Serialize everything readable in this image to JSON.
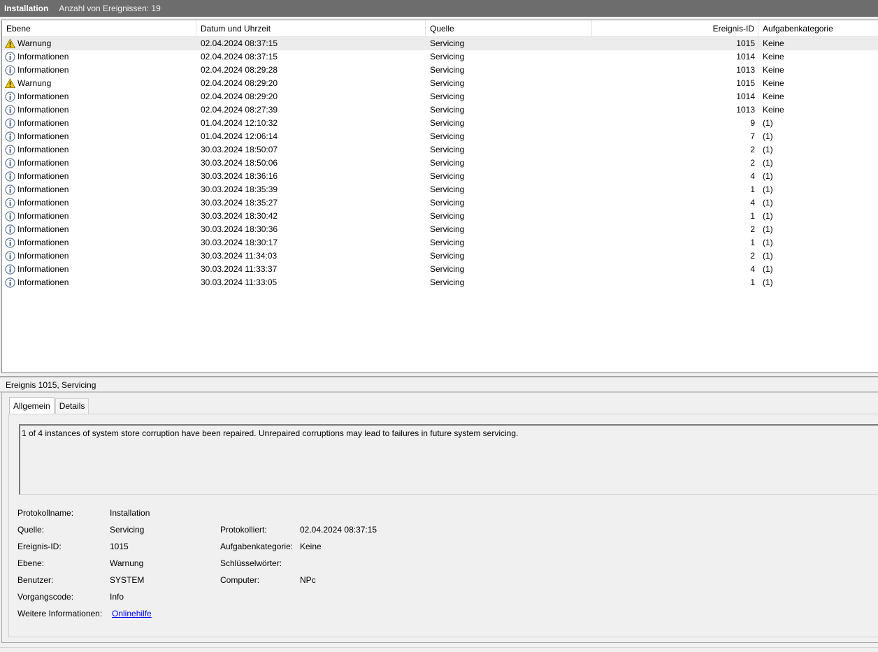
{
  "title_bar": {
    "title": "Installation",
    "count_text": "Anzahl von Ereignissen: 19"
  },
  "columns": [
    "Ebene",
    "Datum und Uhrzeit",
    "Quelle",
    "Ereignis-ID",
    "Aufgabenkategorie"
  ],
  "icons": {
    "warning": "warning-icon",
    "info": "info-icon"
  },
  "events": [
    {
      "icon": "warning",
      "level": "Warnung",
      "date": "02.04.2024 08:37:15",
      "source": "Servicing",
      "id": "1015",
      "category": "Keine"
    },
    {
      "icon": "info",
      "level": "Informationen",
      "date": "02.04.2024 08:37:15",
      "source": "Servicing",
      "id": "1014",
      "category": "Keine"
    },
    {
      "icon": "info",
      "level": "Informationen",
      "date": "02.04.2024 08:29:28",
      "source": "Servicing",
      "id": "1013",
      "category": "Keine"
    },
    {
      "icon": "warning",
      "level": "Warnung",
      "date": "02.04.2024 08:29:20",
      "source": "Servicing",
      "id": "1015",
      "category": "Keine"
    },
    {
      "icon": "info",
      "level": "Informationen",
      "date": "02.04.2024 08:29:20",
      "source": "Servicing",
      "id": "1014",
      "category": "Keine"
    },
    {
      "icon": "info",
      "level": "Informationen",
      "date": "02.04.2024 08:27:39",
      "source": "Servicing",
      "id": "1013",
      "category": "Keine"
    },
    {
      "icon": "info",
      "level": "Informationen",
      "date": "01.04.2024 12:10:32",
      "source": "Servicing",
      "id": "9",
      "category": "(1)"
    },
    {
      "icon": "info",
      "level": "Informationen",
      "date": "01.04.2024 12:06:14",
      "source": "Servicing",
      "id": "7",
      "category": "(1)"
    },
    {
      "icon": "info",
      "level": "Informationen",
      "date": "30.03.2024 18:50:07",
      "source": "Servicing",
      "id": "2",
      "category": "(1)"
    },
    {
      "icon": "info",
      "level": "Informationen",
      "date": "30.03.2024 18:50:06",
      "source": "Servicing",
      "id": "2",
      "category": "(1)"
    },
    {
      "icon": "info",
      "level": "Informationen",
      "date": "30.03.2024 18:36:16",
      "source": "Servicing",
      "id": "4",
      "category": "(1)"
    },
    {
      "icon": "info",
      "level": "Informationen",
      "date": "30.03.2024 18:35:39",
      "source": "Servicing",
      "id": "1",
      "category": "(1)"
    },
    {
      "icon": "info",
      "level": "Informationen",
      "date": "30.03.2024 18:35:27",
      "source": "Servicing",
      "id": "4",
      "category": "(1)"
    },
    {
      "icon": "info",
      "level": "Informationen",
      "date": "30.03.2024 18:30:42",
      "source": "Servicing",
      "id": "1",
      "category": "(1)"
    },
    {
      "icon": "info",
      "level": "Informationen",
      "date": "30.03.2024 18:30:36",
      "source": "Servicing",
      "id": "2",
      "category": "(1)"
    },
    {
      "icon": "info",
      "level": "Informationen",
      "date": "30.03.2024 18:30:17",
      "source": "Servicing",
      "id": "1",
      "category": "(1)"
    },
    {
      "icon": "info",
      "level": "Informationen",
      "date": "30.03.2024 11:34:03",
      "source": "Servicing",
      "id": "2",
      "category": "(1)"
    },
    {
      "icon": "info",
      "level": "Informationen",
      "date": "30.03.2024 11:33:37",
      "source": "Servicing",
      "id": "4",
      "category": "(1)"
    },
    {
      "icon": "info",
      "level": "Informationen",
      "date": "30.03.2024 11:33:05",
      "source": "Servicing",
      "id": "1",
      "category": "(1)"
    }
  ],
  "detail": {
    "title": "Ereignis 1015, Servicing",
    "tabs": [
      "Allgemein",
      "Details"
    ],
    "description": "1 of 4 instances of system store corruption have been repaired. Unrepaired corruptions may lead to failures in future system servicing.",
    "labels": {
      "log_name": "Protokollname:",
      "source": "Quelle:",
      "event_id": "Ereignis-ID:",
      "level": "Ebene:",
      "user": "Benutzer:",
      "opcode": "Vorgangscode:",
      "more_info": "Weitere Informationen:",
      "logged": "Protokolliert:",
      "task_category": "Aufgabenkategorie:",
      "keywords": "Schlüsselwörter:",
      "computer": "Computer:"
    },
    "values": {
      "log_name": "Installation",
      "source": "Servicing",
      "event_id": "1015",
      "level": "Warnung",
      "user": "SYSTEM",
      "opcode": "Info",
      "more_info_link": "Onlinehilfe",
      "logged": "02.04.2024 08:37:15",
      "task_category": "Keine",
      "keywords": "",
      "computer": "NPc"
    }
  },
  "colors": {
    "title_bar": "#6d6d6d",
    "selected_row": "#ececec",
    "link": "#0000ee",
    "warning": "#f2c811"
  }
}
